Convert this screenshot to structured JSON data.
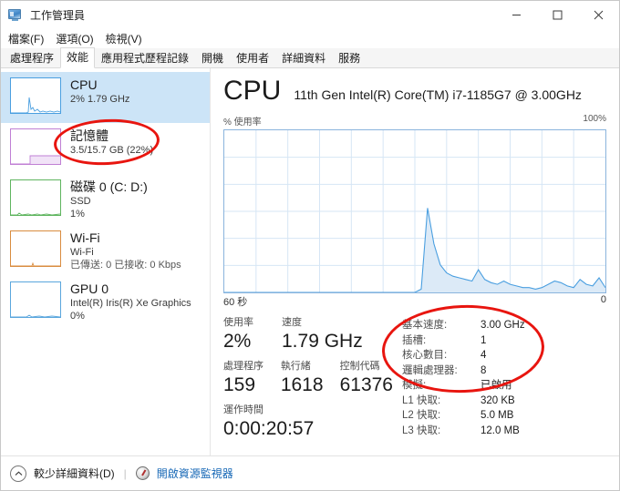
{
  "window": {
    "title": "工作管理員",
    "icon": "task-manager-icon",
    "controls": {
      "minimize": "–",
      "maximize": "□",
      "close": "✕"
    }
  },
  "menu": {
    "items": [
      {
        "label": "檔案(F)"
      },
      {
        "label": "選項(O)"
      },
      {
        "label": "檢視(V)"
      }
    ]
  },
  "tabs": {
    "items": [
      {
        "label": "處理程序",
        "active": false
      },
      {
        "label": "效能",
        "active": true
      },
      {
        "label": "應用程式歷程記錄",
        "active": false
      },
      {
        "label": "開機",
        "active": false
      },
      {
        "label": "使用者",
        "active": false
      },
      {
        "label": "詳細資料",
        "active": false
      },
      {
        "label": "服務",
        "active": false
      }
    ]
  },
  "sidebar": {
    "items": [
      {
        "name": "cpu",
        "title": "CPU",
        "line1": "2%  1.79 GHz",
        "line2": "",
        "selected": true,
        "color": "#4a9fe0"
      },
      {
        "name": "memory",
        "title": "記憶體",
        "line1": "3.5/15.7 GB (22%)",
        "line2": "",
        "selected": false,
        "color": "#c07fd4"
      },
      {
        "name": "disk-0",
        "title": "磁碟 0 (C: D:)",
        "line1": "SSD",
        "line2": "1%",
        "selected": false,
        "color": "#5fb55f"
      },
      {
        "name": "wifi",
        "title": "Wi-Fi",
        "line1": "Wi-Fi",
        "line2": "已傳送: 0  已接收: 0 Kbps",
        "selected": false,
        "color": "#d98c3f"
      },
      {
        "name": "gpu-0",
        "title": "GPU 0",
        "line1": "Intel(R) Iris(R) Xe Graphics",
        "line2": "0%",
        "selected": false,
        "color": "#5aa6dd"
      }
    ]
  },
  "main": {
    "heading": "CPU",
    "subheading": "11th Gen Intel(R) Core(TM) i7-1185G7 @ 3.00GHz",
    "chart_top_left_label": "% 使用率",
    "chart_top_right_label": "100%",
    "chart_bottom_left_label": "60 秒",
    "chart_bottom_right_label": "0",
    "stats_left": [
      {
        "label": "使用率",
        "value": "2%"
      },
      {
        "label": "速度",
        "value": "1.79 GHz"
      },
      {
        "label": "處理程序",
        "value": "159"
      },
      {
        "label": "執行緒",
        "value": "1618"
      },
      {
        "label": "控制代碼",
        "value": "61376"
      },
      {
        "label": "運作時間",
        "value": "0:00:20:57"
      }
    ],
    "stats_right": [
      {
        "label": "基本速度:",
        "value": "3.00 GHz"
      },
      {
        "label": "插槽:",
        "value": "1"
      },
      {
        "label": "核心數目:",
        "value": "4"
      },
      {
        "label": "邏輯處理器:",
        "value": "8"
      },
      {
        "label": "模擬:",
        "value": "已啟用"
      },
      {
        "label": "L1 快取:",
        "value": "320 KB"
      },
      {
        "label": "L2 快取:",
        "value": "5.0 MB"
      },
      {
        "label": "L3 快取:",
        "value": "12.0 MB"
      }
    ]
  },
  "footer": {
    "collapse_label": "較少詳細資料(D)",
    "separator": "|",
    "resource_monitor_label": "開啟資源監視器"
  },
  "annotations": [
    {
      "name": "memory-highlight",
      "shape": "ellipse",
      "color": "#e8150f"
    },
    {
      "name": "cpu-info-highlight",
      "shape": "ellipse",
      "color": "#e8150f"
    }
  ],
  "chart_data": {
    "type": "area",
    "title": "CPU % 使用率",
    "xlabel": "",
    "ylabel": "% 使用率",
    "xlim": [
      60,
      0
    ],
    "ylim": [
      0,
      100
    ],
    "x_tick_labels": [
      "60 秒",
      "0"
    ],
    "y_tick_labels": [
      "100%"
    ],
    "grid": true,
    "line_color": "#4a9fe0",
    "fill_color": "#dceaf7",
    "series": [
      {
        "name": "CPU 使用率",
        "x": [
          60,
          58,
          56,
          54,
          52,
          50,
          48,
          46,
          44,
          42,
          40,
          38,
          36,
          34,
          33,
          32,
          31,
          30,
          29,
          28,
          27,
          26,
          25,
          24,
          23,
          22,
          21,
          20,
          19,
          18,
          17,
          16,
          15,
          14,
          13,
          12,
          11,
          10,
          9,
          8,
          7,
          6,
          5,
          4,
          3,
          2,
          1,
          0
        ],
        "values": [
          0,
          0,
          0,
          0,
          0,
          0,
          0,
          0,
          0,
          0,
          0,
          0,
          0,
          0,
          0,
          0,
          0,
          0,
          2,
          52,
          30,
          17,
          12,
          10,
          9,
          8,
          7,
          14,
          8,
          6,
          5,
          7,
          5,
          4,
          3,
          3,
          2,
          3,
          5,
          7,
          6,
          4,
          3,
          8,
          5,
          4,
          9,
          3
        ]
      }
    ]
  }
}
